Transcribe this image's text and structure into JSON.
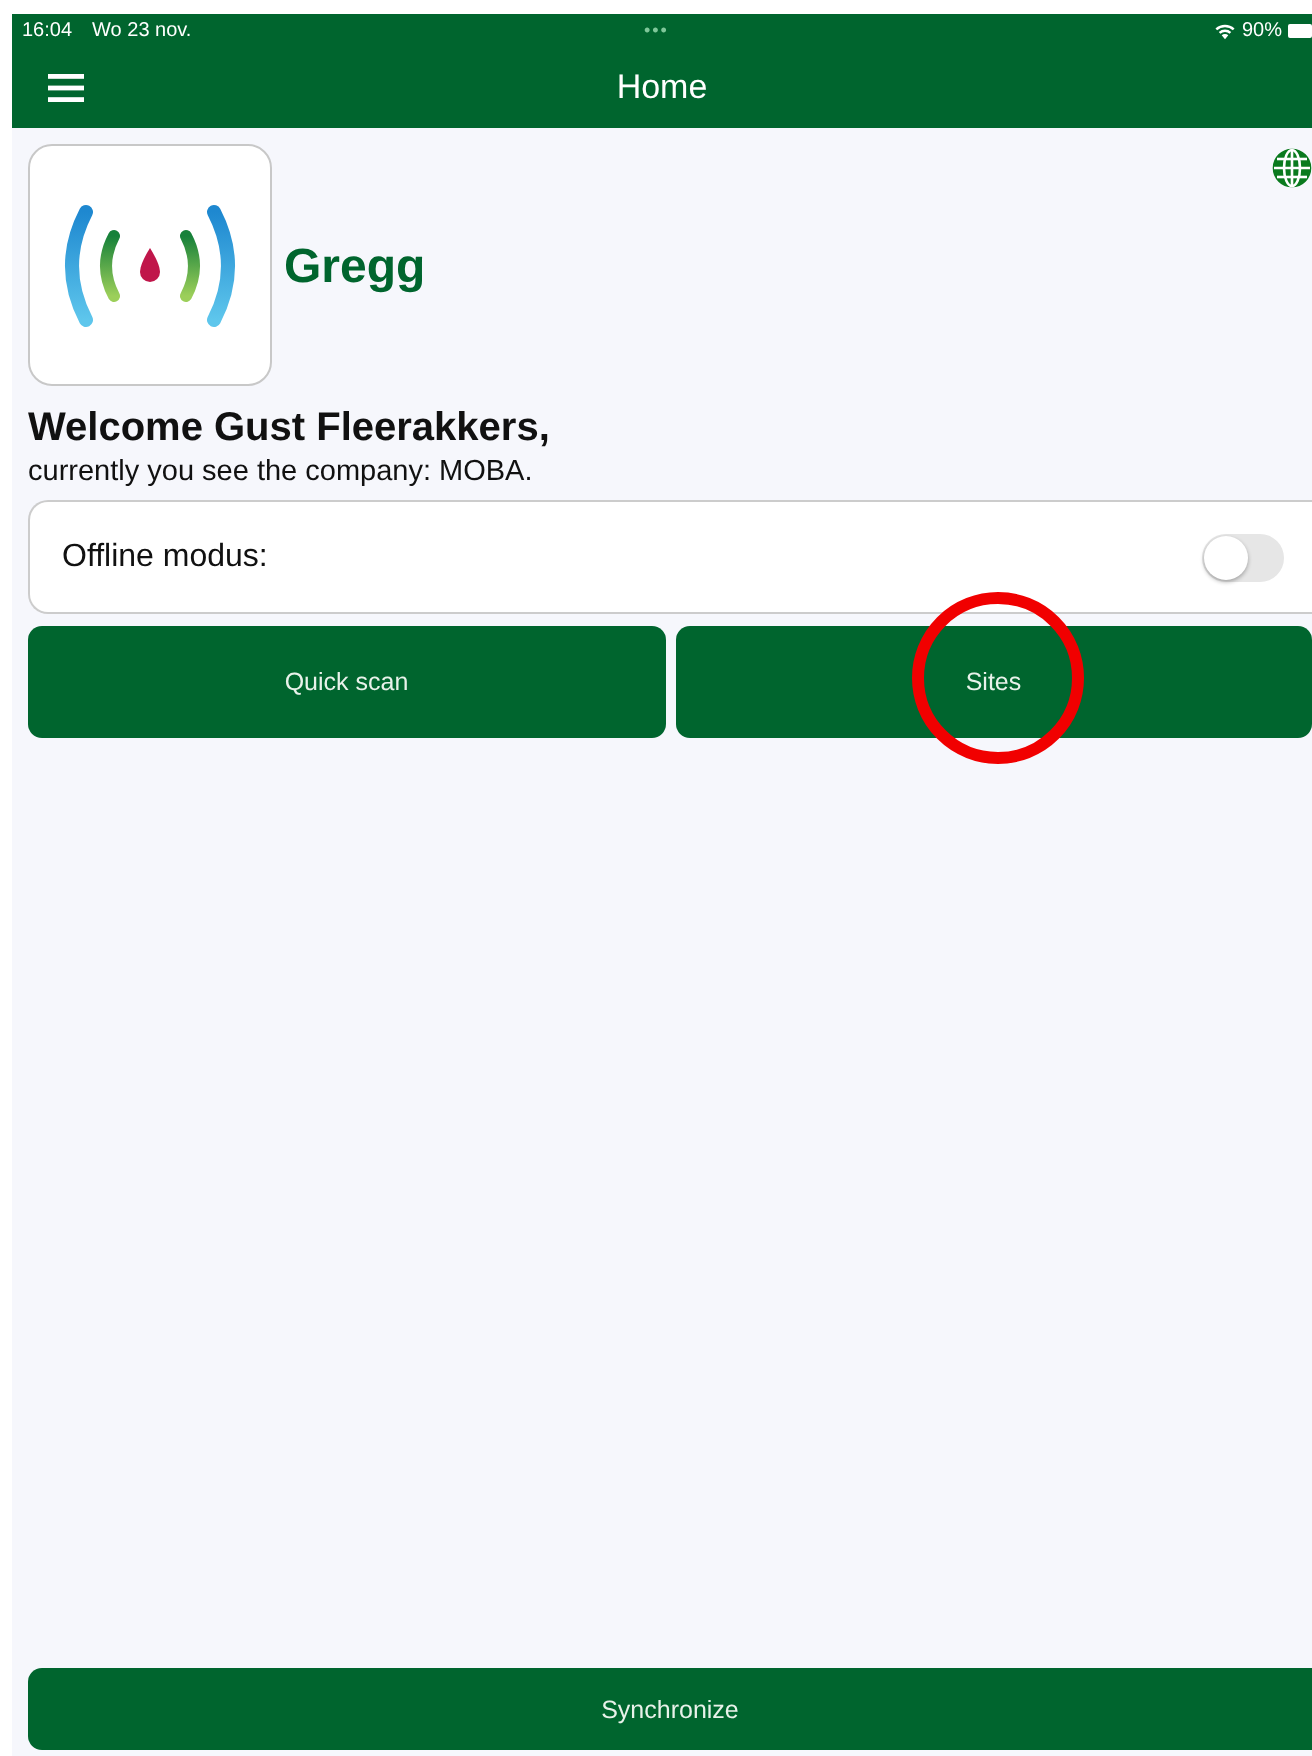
{
  "status_bar": {
    "time": "16:04",
    "date": "Wo 23 nov.",
    "dots": "•••",
    "battery": "90%"
  },
  "header": {
    "title": "Home"
  },
  "brand": {
    "name": "Gregg"
  },
  "welcome": {
    "title": "Welcome Gust Fleerakkers,",
    "subtitle": "currently you see the company: MOBA."
  },
  "offline": {
    "label": "Offline modus:",
    "on": false
  },
  "actions": [
    {
      "label": "Quick scan",
      "highlighted": false
    },
    {
      "label": "Sites",
      "highlighted": true
    }
  ],
  "footer_button": {
    "label": "Synchronize"
  }
}
